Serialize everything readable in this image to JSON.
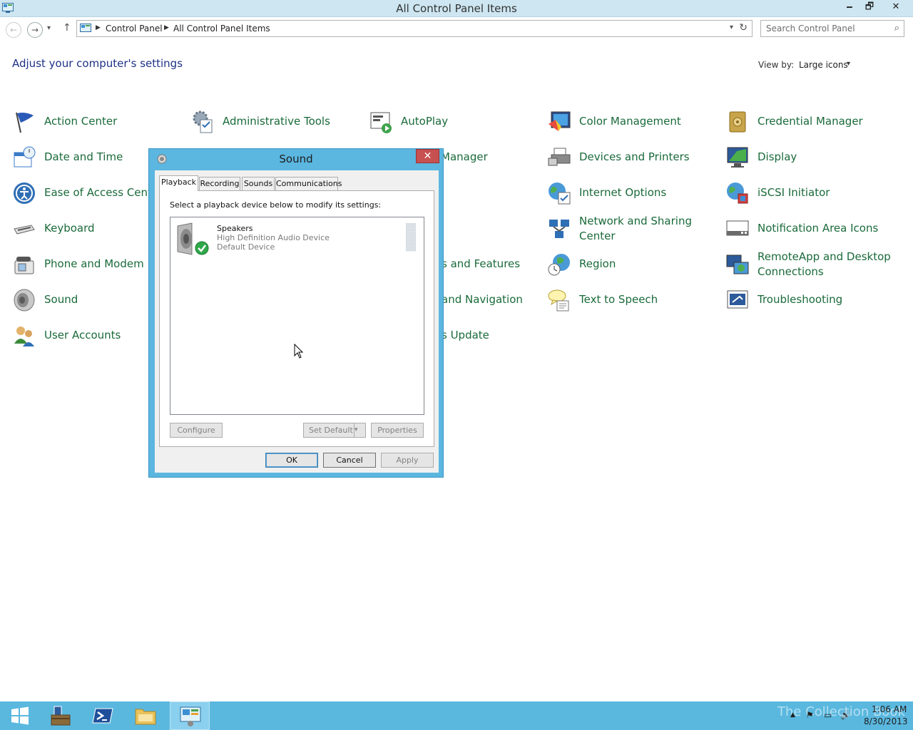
{
  "window": {
    "title": "All Control Panel Items",
    "minimize": "🗕",
    "maximize": "🗗",
    "close": "✕"
  },
  "nav": {
    "back": "←",
    "forward": "→",
    "dropdown": "▾",
    "up": "↑",
    "breadcrumbs": [
      "Control Panel",
      "All Control Panel Items"
    ],
    "refresh": "↻",
    "search_placeholder": "Search Control Panel",
    "search_icon": "⌕"
  },
  "content": {
    "heading": "Adjust your computer's settings",
    "view_by_label": "View by:",
    "view_by_value": "Large icons",
    "view_by_arrow": "▾"
  },
  "items": [
    {
      "label": "Action Center",
      "icon": "flag-icon"
    },
    {
      "label": "Administrative Tools",
      "icon": "admin-tools-icon"
    },
    {
      "label": "AutoPlay",
      "icon": "autoplay-icon"
    },
    {
      "label": "Color Management",
      "icon": "color-management-icon"
    },
    {
      "label": "Credential Manager",
      "icon": "credential-manager-icon"
    },
    {
      "label": "Date and Time",
      "icon": "calendar-clock-icon"
    },
    {
      "label": "Manager",
      "icon": "device-manager-icon"
    },
    {
      "label": "Devices and Printers",
      "icon": "printer-icon"
    },
    {
      "label": "Display",
      "icon": "monitor-icon"
    },
    {
      "label": "Ease of Access Center",
      "icon": "ease-of-access-icon"
    },
    {
      "label": "Internet Options",
      "icon": "globe-icon"
    },
    {
      "label": "iSCSI Initiator",
      "icon": "iscsi-icon"
    },
    {
      "label": "Keyboard",
      "icon": "keyboard-icon"
    },
    {
      "label": "Network and Sharing Center",
      "icon": "network-icon"
    },
    {
      "label": "Notification Area Icons",
      "icon": "notification-area-icon"
    },
    {
      "label": "Phone and Modem",
      "icon": "phone-icon"
    },
    {
      "label": "s and Features",
      "icon": "programs-icon"
    },
    {
      "label": "Region",
      "icon": "region-icon"
    },
    {
      "label": "RemoteApp and Desktop Connections",
      "icon": "remoteapp-icon"
    },
    {
      "label": "Sound",
      "icon": "speaker-icon"
    },
    {
      "label": "and Navigation",
      "icon": "navigation-icon"
    },
    {
      "label": "Text to Speech",
      "icon": "speech-bubble-icon"
    },
    {
      "label": "Troubleshooting",
      "icon": "troubleshooting-icon"
    },
    {
      "label": "User Accounts",
      "icon": "users-icon"
    },
    {
      "label": "s Update",
      "icon": "windows-update-icon"
    }
  ],
  "dialog": {
    "title": "Sound",
    "close": "✕",
    "tabs": [
      "Playback",
      "Recording",
      "Sounds",
      "Communications"
    ],
    "instruction": "Select a playback device below to modify its settings:",
    "device": {
      "name": "Speakers",
      "description": "High Definition Audio Device",
      "status": "Default Device"
    },
    "buttons": {
      "configure": "Configure",
      "set_default": "Set Default",
      "set_default_arrow": "▾",
      "properties": "Properties",
      "ok": "OK",
      "cancel": "Cancel",
      "apply": "Apply"
    }
  },
  "taskbar": {
    "apps": [
      "start-icon",
      "server-manager-icon",
      "powershell-icon",
      "file-explorer-icon",
      "control-panel-icon"
    ],
    "watermark": "The Collection Book",
    "tray": [
      "▲",
      "⚑",
      "▭",
      "🔊"
    ],
    "time": "1:06 AM",
    "date": "8/30/2013"
  },
  "colors": {
    "link": "#1a6a3a",
    "heading": "#1e3287",
    "dialog_frame": "#5bb6e0",
    "taskbar": "#5ab8df"
  }
}
